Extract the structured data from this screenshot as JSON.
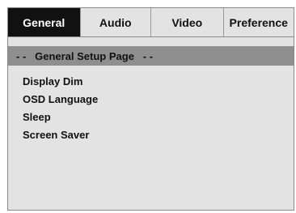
{
  "tabs": [
    {
      "label": "General",
      "active": true
    },
    {
      "label": "Audio",
      "active": false
    },
    {
      "label": "Video",
      "active": false
    },
    {
      "label": "Preference",
      "active": false
    }
  ],
  "page_header": "- -   General Setup Page   - -",
  "menu_items": [
    {
      "label": "Display Dim"
    },
    {
      "label": "OSD Language"
    },
    {
      "label": "Sleep"
    },
    {
      "label": "Screen Saver"
    }
  ],
  "colors": {
    "active_tab_bg": "#111111",
    "active_tab_text": "#ffffff",
    "panel_bg": "#e3e3e3",
    "header_bar_bg": "#8f8f8f"
  }
}
